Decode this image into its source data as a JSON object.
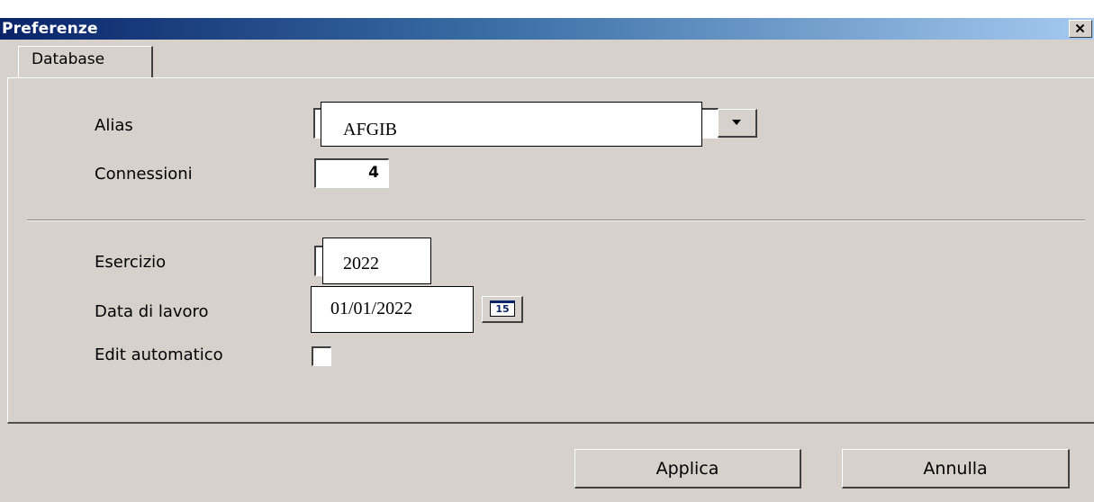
{
  "window": {
    "title": "Preferenze"
  },
  "tabs": [
    {
      "label": "Database"
    }
  ],
  "form": {
    "alias": {
      "label": "Alias",
      "value": "AFGIB"
    },
    "connessioni": {
      "label": "Connessioni",
      "value": "4"
    },
    "esercizio": {
      "label": "Esercizio",
      "value": "2022"
    },
    "data_lavoro": {
      "label": "Data di lavoro",
      "value": "01/01/2022",
      "calendar_icon_text": "15"
    },
    "edit_automatico": {
      "label": "Edit automatico",
      "checked": false
    }
  },
  "buttons": {
    "apply": "Applica",
    "cancel": "Annulla"
  },
  "icons": {
    "close": "close-icon",
    "dropdown": "chevron-down-icon",
    "calendar": "calendar-icon"
  },
  "colors": {
    "title_start": "#0a246a",
    "title_end": "#a6caf0",
    "face": "#d6d2cb"
  }
}
